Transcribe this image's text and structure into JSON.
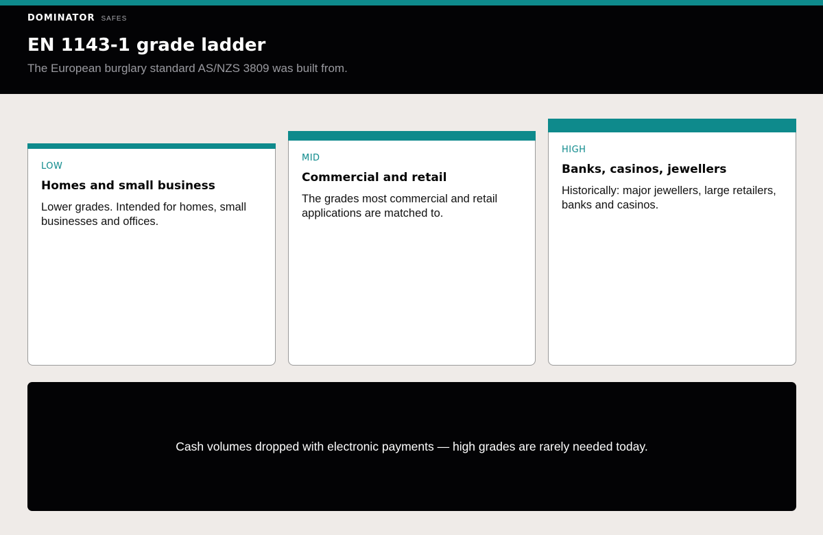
{
  "brand": {
    "name": "DOMINATOR",
    "sub": "SAFES"
  },
  "header": {
    "title": "EN 1143-1 grade ladder",
    "subtitle": "The European burglary standard AS/NZS 3809 was built from."
  },
  "tiers": [
    {
      "tier": "LOW",
      "title": "Homes and small business",
      "body": "Lower grades. Intended for homes, small businesses and offices."
    },
    {
      "tier": "MID",
      "title": "Commercial and retail",
      "body": "The grades most commercial and retail applications are matched to."
    },
    {
      "tier": "HIGH",
      "title": "Banks, casinos, jewellers",
      "body": "Historically: major jewellers, large retailers, banks and casinos."
    }
  ],
  "footer": {
    "text": "Cash volumes dropped with electronic payments — high grades are rarely needed today."
  },
  "colors": {
    "accent": "#0e8a8c",
    "dark": "#030305",
    "background": "#efebe8"
  }
}
